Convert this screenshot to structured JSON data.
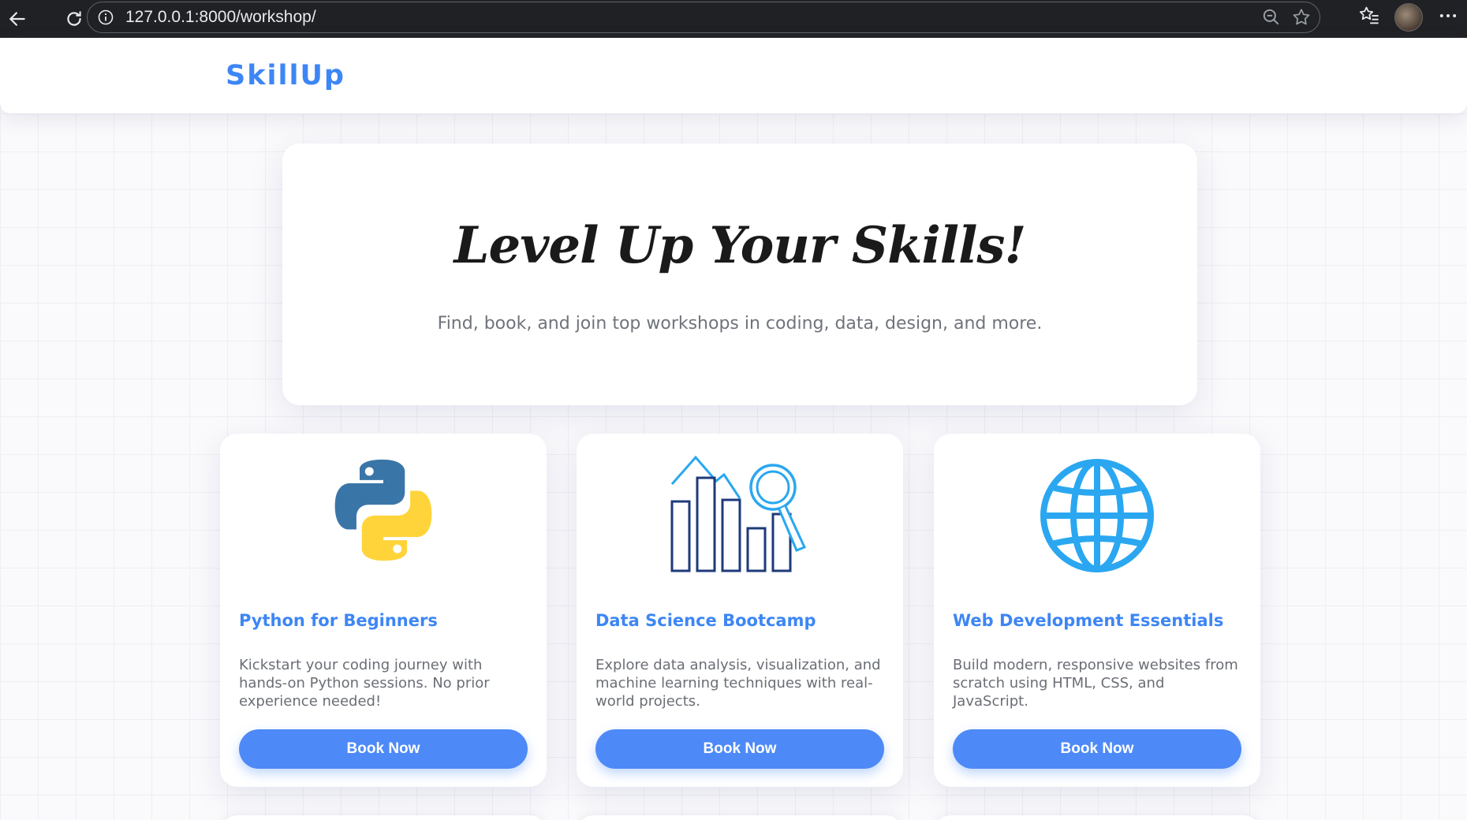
{
  "browser": {
    "url": "127.0.0.1:8000/workshop/"
  },
  "header": {
    "logo": "SkillUp"
  },
  "hero": {
    "title": "Level Up Your Skills!",
    "subtitle": "Find, book, and join top workshops in coding, data, design, and more."
  },
  "workshops": [
    {
      "icon": "python-logo-icon",
      "title": "Python for Beginners",
      "description": "Kickstart your coding journey with hands-on Python sessions. No prior experience needed!",
      "button": "Book Now"
    },
    {
      "icon": "data-chart-magnifier-icon",
      "title": "Data Science Bootcamp",
      "description": "Explore data analysis, visualization, and machine learning techniques with real-world projects.",
      "button": "Book Now"
    },
    {
      "icon": "globe-icon",
      "title": "Web Development Essentials",
      "description": "Build modern, responsive websites from scratch using HTML, CSS, and JavaScript.",
      "button": "Book Now"
    }
  ],
  "colors": {
    "brand": "#3d86f5",
    "button": "#4d8af7",
    "python_blue": "#3a75a8",
    "python_yellow": "#ffd43b",
    "data_navy": "#1e3a7a",
    "globe_blue": "#2aa7f0"
  }
}
